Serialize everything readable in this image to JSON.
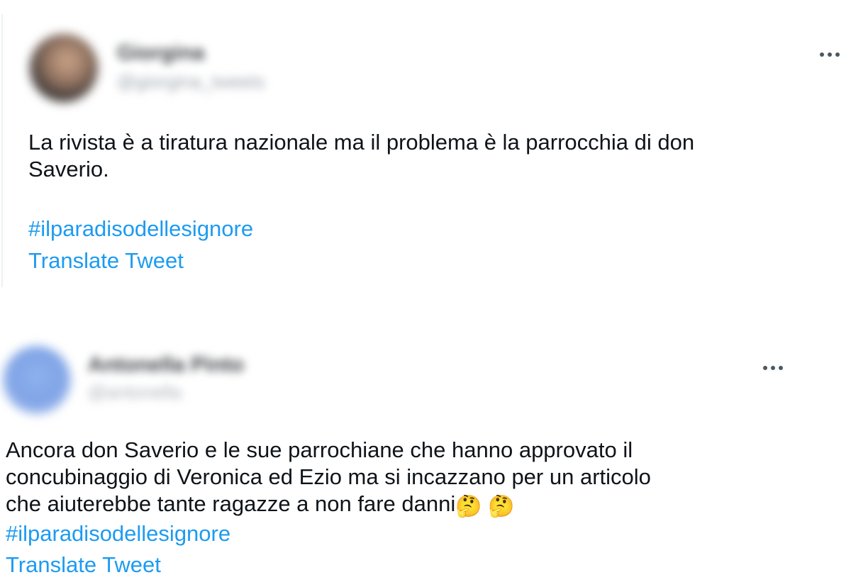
{
  "tweets": [
    {
      "author_name": "Giorgina",
      "author_handle": "@giorgina_tweets",
      "text": "La rivista è a tiratura nazionale ma il problema è la parrocchia di don\nSaverio.",
      "hashtag": "#ilparadisodellesignore",
      "translate_label": "Translate Tweet",
      "more_icon": "more-horizontal-icon"
    },
    {
      "author_name": "Antonella Pinto",
      "author_handle": "@antonella",
      "text": "Ancora don Saverio e le sue parrochiane che hanno approvato il\nconcubinaggio di Veronica ed Ezio ma si incazzano per un articolo\nche aiuterebbe tante ragazze a non fare danni",
      "emojis": [
        "🤔",
        "🤔"
      ],
      "hashtag": "#ilparadisodellesignore",
      "translate_label": "Translate Tweet",
      "more_icon": "more-horizontal-icon"
    }
  ],
  "colors": {
    "text": "#0f1419",
    "link": "#1d9bf0",
    "icon": "#4b5863"
  }
}
